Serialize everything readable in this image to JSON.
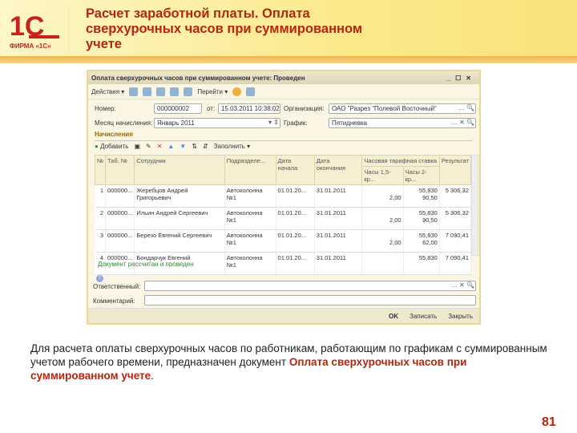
{
  "slide": {
    "logo_text": "ФИРМА «1С»",
    "title": "Расчет заработной платы. Оплата сверхурочных часов при суммированном учете",
    "description_prefix": "Для расчета оплаты сверхурочных часов по работникам, работающим по графикам с суммированным учетом рабочего времени, предназначен документ ",
    "description_highlight": "Оплата сверхурочных часов при суммированном учете",
    "description_suffix": ".",
    "page_number": "81",
    "accent": "#b3260f"
  },
  "window": {
    "title": "Оплата сверхурочных часов при суммированном учете: Проведен",
    "actions": "Действия",
    "goto": "Перейти",
    "number_label": "Номер:",
    "number": "000000002",
    "from_label": "от:",
    "date": "15.03.2011 10:38:02",
    "org_label": "Организация:",
    "org": "ОАО \"Разрез \"Полевой Восточный\"",
    "month_label": "Месяц начисления:",
    "month": "Январь 2011",
    "schedule_label": "График:",
    "schedule": "Пятидневка",
    "section": "Начисления",
    "add": "Добавить",
    "fill": "Заполнить",
    "columns": {
      "n": "№",
      "tab": "Таб. №",
      "emp": "Сотрудник",
      "dept": "Подразделе...",
      "start": "Дата начала",
      "end": "Дата окончания",
      "rate": "Часовая тарифная ставка",
      "h15": "Часы 1,5-кр...",
      "h2": "Часы 2-кр...",
      "result": "Результат"
    },
    "rows": [
      {
        "n": "1",
        "tab": "000000...",
        "emp": "Жеребцов Андрей Григорьевич",
        "dept": "Автоколонна №1",
        "start": "01.01.20...",
        "end": "31.01.2011",
        "rate": "55,830",
        "h15": "2,00",
        "h2": "90,50",
        "result": "5 306,32"
      },
      {
        "n": "2",
        "tab": "000000...",
        "emp": "Ильин Андрей Сергеевич",
        "dept": "Автоколонна №1",
        "start": "01.01.20...",
        "end": "31.01.2011",
        "rate": "55,830",
        "h15": "2,00",
        "h2": "90,50",
        "result": "5 306,32"
      },
      {
        "n": "3",
        "tab": "000000...",
        "emp": "Березо Евгений Сергеевич",
        "dept": "Автоколонна №1",
        "start": "01.01.20...",
        "end": "31.01.2011",
        "rate": "55,830",
        "h15": "2,00",
        "h2": "62,00",
        "result": "7 090,41"
      },
      {
        "n": "4",
        "tab": "000000...",
        "emp": "Бондарчук Евгений",
        "dept": "Автоколонна №1",
        "start": "01.01.20...",
        "end": "31.01.2011",
        "rate": "55,830",
        "h15": "",
        "h2": "",
        "result": "7 090,41"
      }
    ],
    "status": "Документ рассчитан и проведен",
    "responsible_label": "Ответственный:",
    "comment_label": "Комментарий:",
    "ok": "OK",
    "save": "Записать",
    "close": "Закрыть"
  }
}
